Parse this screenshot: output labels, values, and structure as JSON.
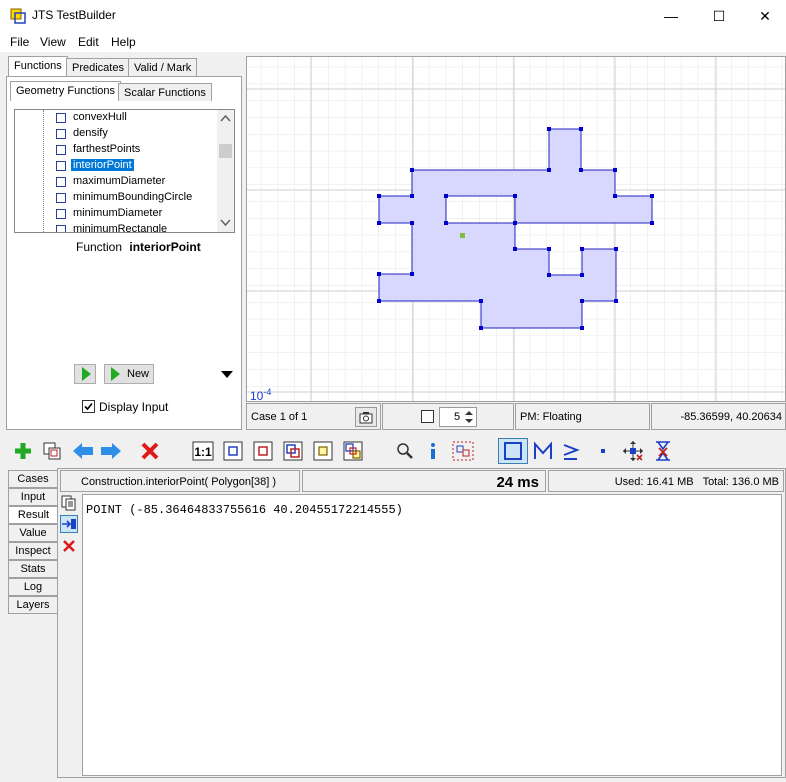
{
  "window": {
    "title": "JTS TestBuilder",
    "minimize": "—",
    "maximize": "☐",
    "close": "✕"
  },
  "menu": [
    "File",
    "View",
    "Edit",
    "Help"
  ],
  "tabs": {
    "functions": "Functions",
    "predicates": "Predicates",
    "valid_mark": "Valid / Mark"
  },
  "subtabs": {
    "geometry": "Geometry Functions",
    "scalar": "Scalar Functions"
  },
  "function_list": [
    "convexHull",
    "densify",
    "farthestPoints",
    "interiorPoint",
    "maximumDiameter",
    "minimumBoundingCircle",
    "minimumDiameter",
    "minimumRectangle"
  ],
  "selected_function": "interiorPoint",
  "function_label": "Function",
  "function_name": "interiorPoint",
  "buttons": {
    "new": "New"
  },
  "display_input": "Display Input",
  "canvas": {
    "scale": "10",
    "scale_exp": "-4"
  },
  "status": {
    "case": "Case 1 of 1",
    "spinner_value": "5",
    "pm": "PM: Floating",
    "coords": "-85.36599, 40.20634"
  },
  "bottom_tabs": [
    "Cases",
    "Input",
    "Result",
    "Value",
    "Inspect",
    "Stats",
    "Log",
    "Layers"
  ],
  "active_bottom_tab": "Result",
  "result": {
    "expression": "Construction.interiorPoint( Polygon[38] )",
    "time": "24 ms",
    "memory": "Used: 16.41 MB   Total: 136.0 MB",
    "text": "POINT (-85.36464833755616 40.20455172214555)"
  },
  "colors": {
    "polygon_fill": "#d8d8ff",
    "polygon_stroke": "#2020c0",
    "vertex": "#0000cc",
    "point": "#7fbf3f",
    "selection": "#0078d7"
  }
}
